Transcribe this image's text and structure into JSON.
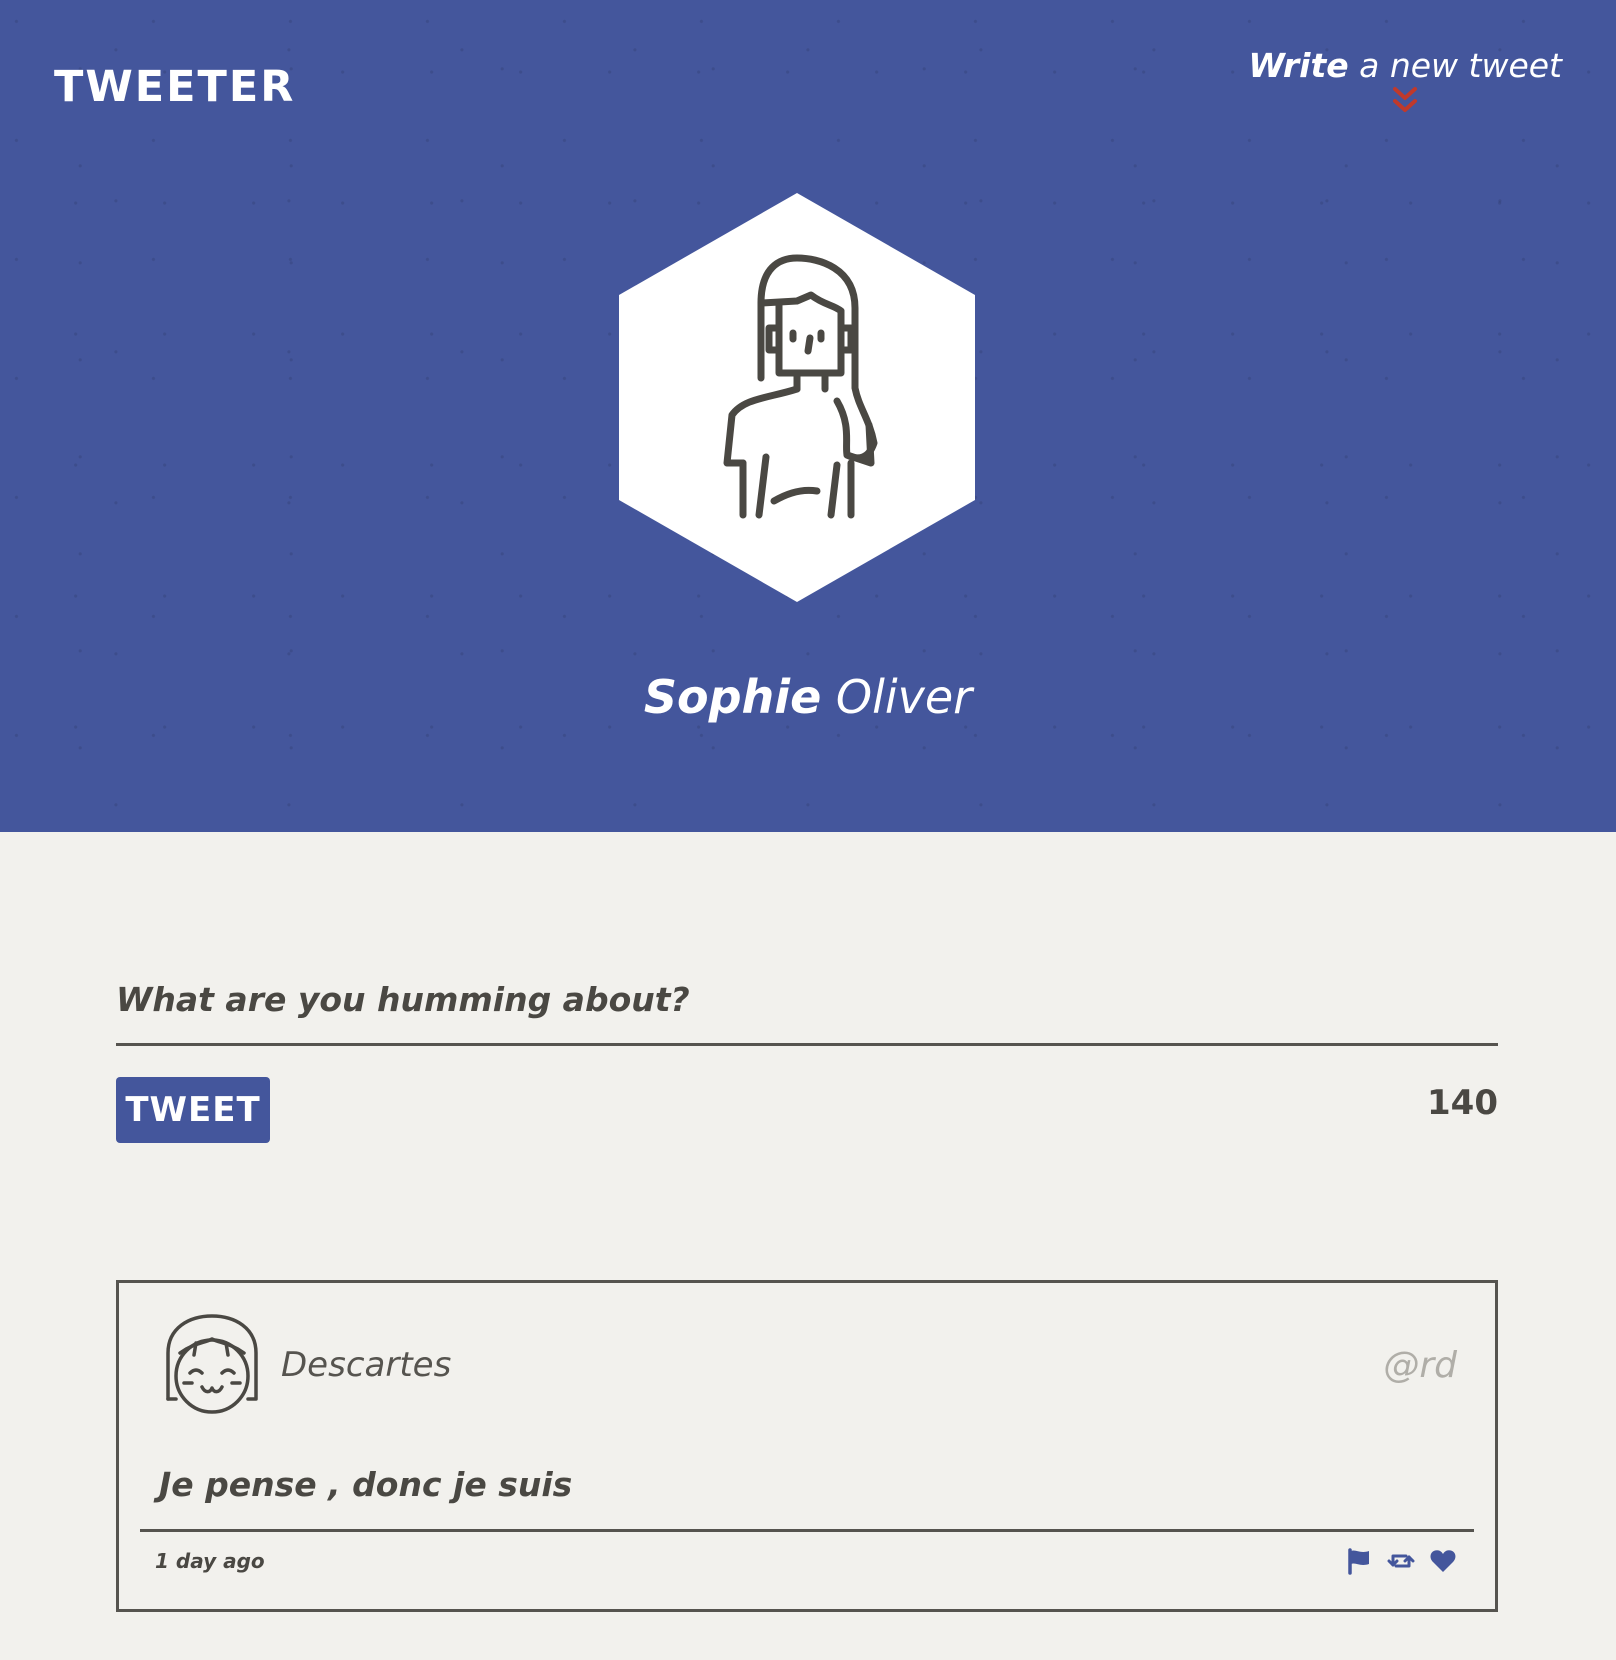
{
  "header": {
    "logo_text": "TWEETER",
    "write_link": {
      "bold": "Write",
      "rest": " a new tweet"
    },
    "user": {
      "first_name": "Sophie",
      "last_name": " Oliver"
    },
    "avatar_icon": "woman-avatar-icon",
    "chevron_icon": "double-chevron-down-icon"
  },
  "compose": {
    "placeholder": "What are you humming about?",
    "button_label": "TWEET",
    "char_count": "140"
  },
  "tweets": [
    {
      "author": "Descartes",
      "handle": "@rd",
      "text": "Je pense , donc je suis",
      "time": "1 day ago",
      "avatar_icon": "girl-avatar-icon",
      "actions": [
        "flag-icon",
        "retweet-icon",
        "heart-icon"
      ]
    }
  ],
  "colors": {
    "header_bg": "#44569c",
    "page_bg": "#f2f1ed",
    "text_dark": "#4a4843",
    "accent_red": "#c0392b",
    "handle_grey": "#b0aea8"
  }
}
